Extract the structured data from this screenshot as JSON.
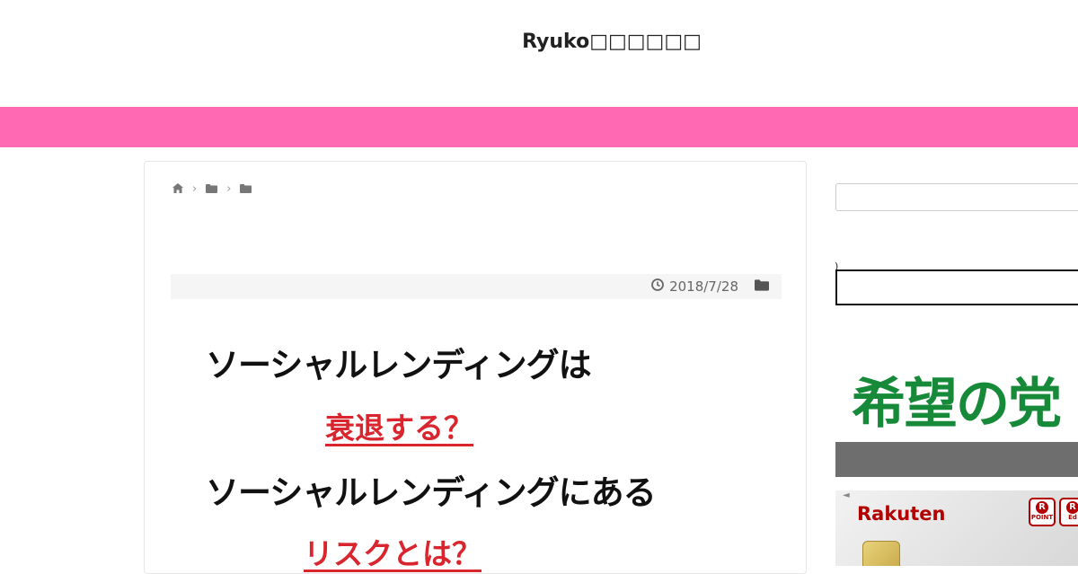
{
  "header": {
    "site_title": "Ryuko□□□□□□"
  },
  "breadcrumb": {
    "icons": [
      "home-icon",
      "folder-icon",
      "folder-icon"
    ],
    "separator": "›"
  },
  "post": {
    "date": "2018/7/28",
    "headline": {
      "line1": "ソーシャルレンディングは",
      "line2": "衰退する？",
      "line3": "ソーシャルレンディングにある",
      "line4": "リスクとは？"
    }
  },
  "sidebar": {
    "mark": ")",
    "party_banner_text": "希望の党",
    "card_ad": {
      "brand": "Rakuten",
      "badge1": "POINT",
      "badge1_mark": "R",
      "badge2": "Ed",
      "badge2_mark": "R",
      "corner_mark": "◄"
    }
  },
  "colors": {
    "accent_band": "#ff69b4",
    "headline_red": "#d9262e",
    "party_green": "#178a3a",
    "gray_bar": "#6e6e6e"
  }
}
